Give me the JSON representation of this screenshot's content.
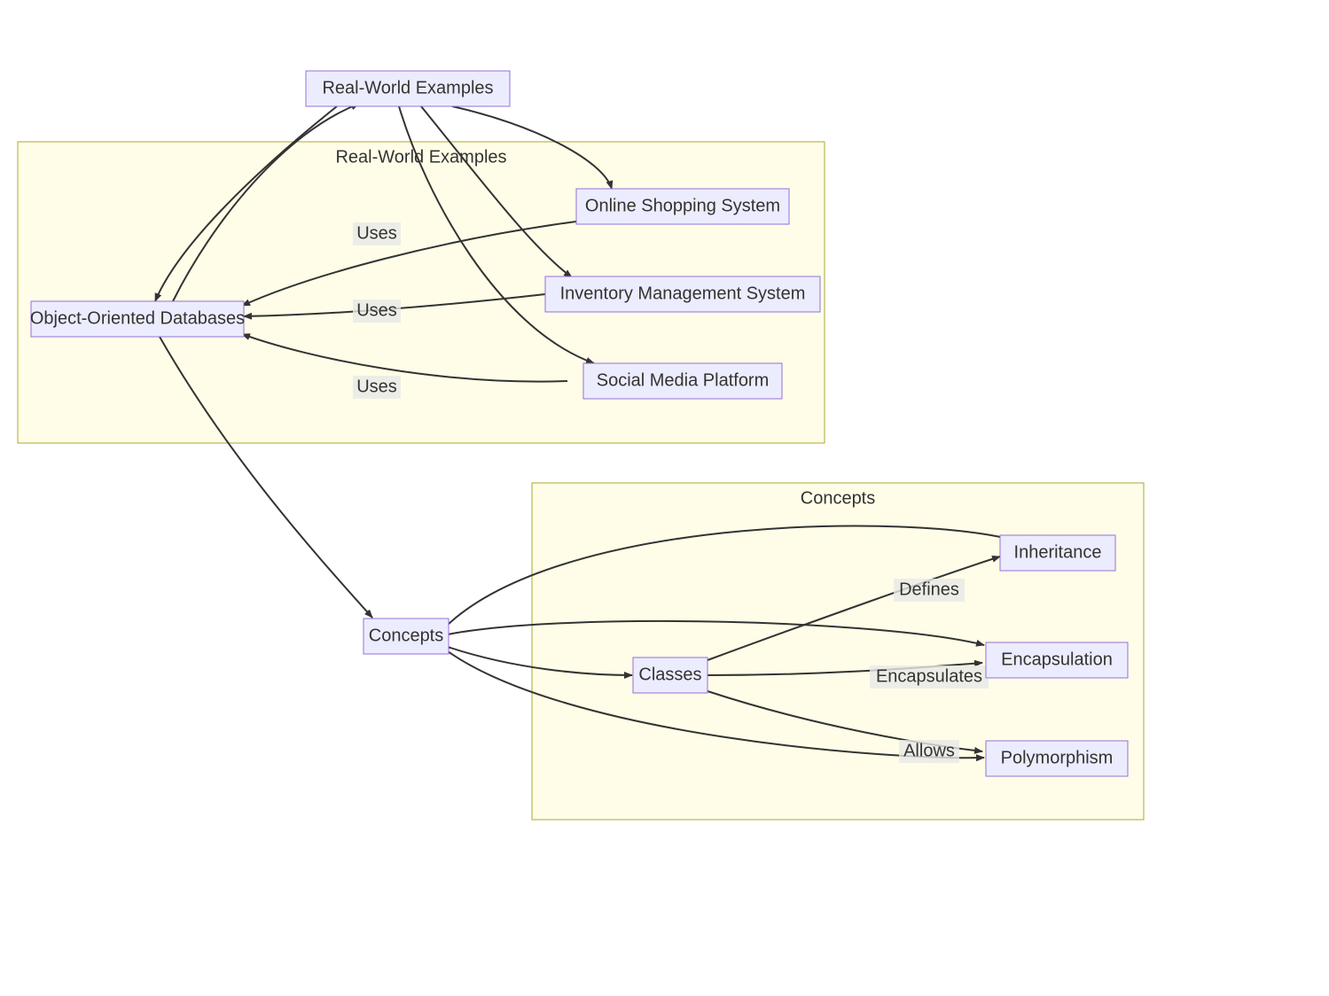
{
  "nodes": {
    "realWorldExamples": "Real-World Examples",
    "oodb": "Object-Oriented Databases",
    "onlineShopping": "Online Shopping System",
    "inventory": "Inventory Management System",
    "socialMedia": "Social Media Platform",
    "concepts": "Concepts",
    "classes": "Classes",
    "inheritance": "Inheritance",
    "encapsulation": "Encapsulation",
    "polymorphism": "Polymorphism"
  },
  "subgraphs": {
    "examples": "Real-World Examples",
    "concepts": "Concepts"
  },
  "edgeLabels": {
    "uses": "Uses",
    "defines": "Defines",
    "encapsulates": "Encapsulates",
    "allows": "Allows"
  }
}
